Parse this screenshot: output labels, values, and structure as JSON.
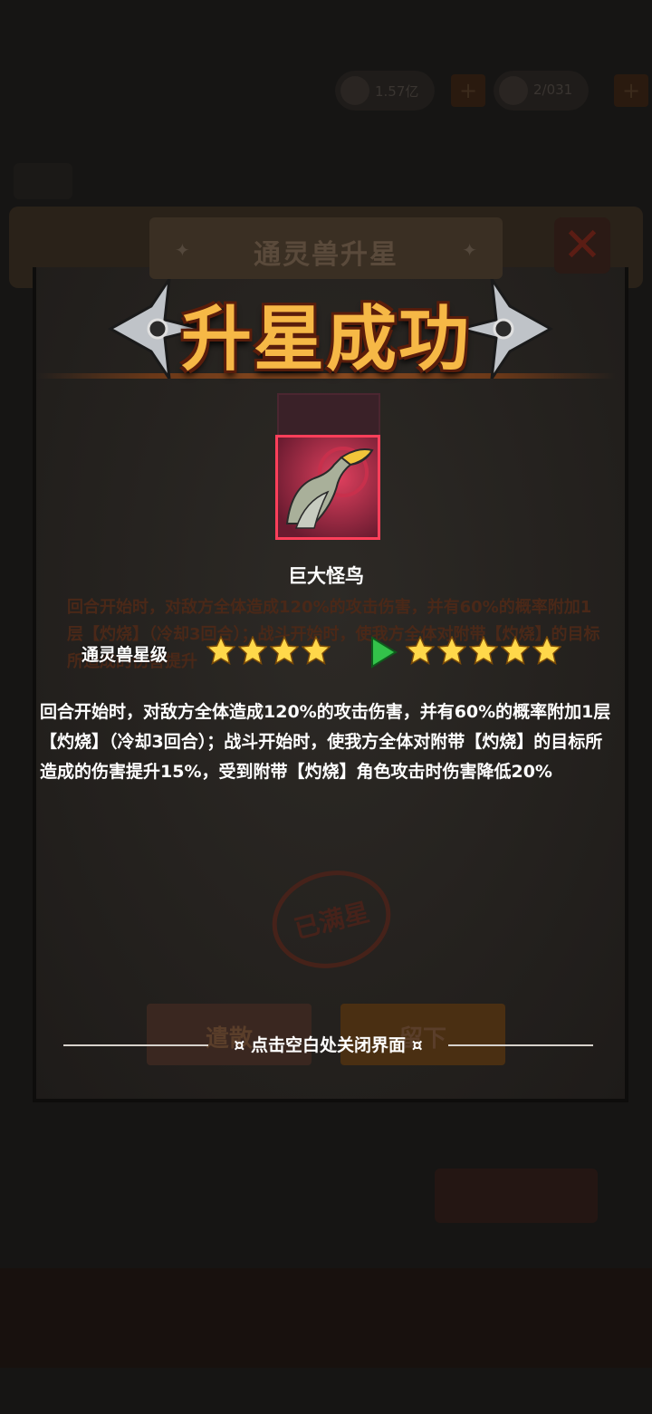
{
  "header": {
    "coins": "1.57亿",
    "gems": "2/031"
  },
  "dialog": {
    "title": "通灵兽升星",
    "banner": "升星成功",
    "beast_name": "巨大怪鸟",
    "old_description": "回合开始时，对敌方全体造成120%的攻击伤害，并有60%的概率附加1层【灼烧】（冷却3回合）；战斗开始时，使我方全体对附带【灼烧】的目标所造成的伤害提升",
    "star_label": "通灵兽星级",
    "stars_before": 4,
    "stars_after": 5,
    "new_description": "回合开始时，对敌方全体造成120%的攻击伤害，并有60%的概率附加1层【灼烧】（冷却3回合）；战斗开始时，使我方全体对附带【灼烧】的目标所造成的伤害提升15%，受到附带【灼烧】角色攻击时伤害降低20%",
    "stamp": "已满星",
    "button_left": "遣散",
    "button_right": "留下",
    "close_hint": "¤ 点击空白处关闭界面 ¤"
  },
  "colors": {
    "banner_gold": "#f6b846",
    "card_border": "#ff3f5a",
    "star_yellow": "#ffd84a",
    "arrow_green": "#33c24a"
  }
}
